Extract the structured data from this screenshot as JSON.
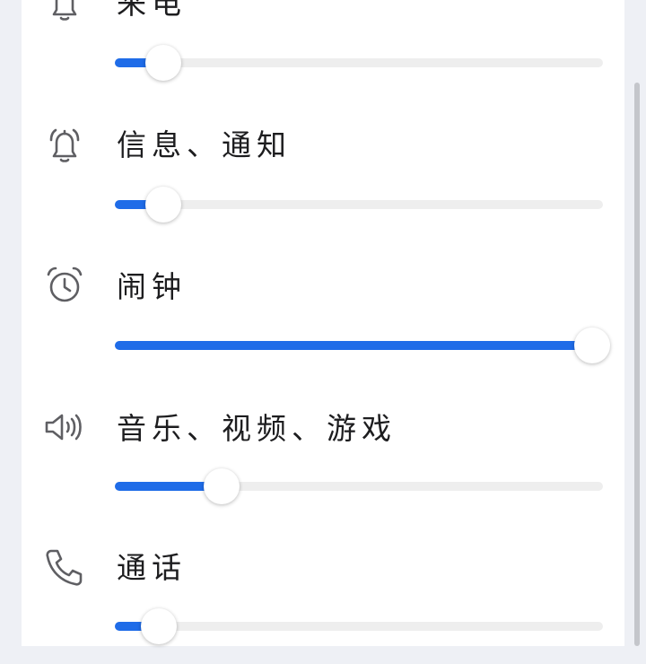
{
  "colors": {
    "accent": "#1f6ce8",
    "track": "#eeeeee",
    "icon": "#5f5f63",
    "text": "#1d1d1f"
  },
  "volume_rows": [
    {
      "label": "来电",
      "icon": "bell-icon",
      "level": 0.07
    },
    {
      "label": "信息、通知",
      "icon": "bell-ringing-icon",
      "level": 0.07
    },
    {
      "label": "闹钟",
      "icon": "alarm-clock-icon",
      "level": 1.0
    },
    {
      "label": "音乐、视频、游戏",
      "icon": "speaker-icon",
      "level": 0.19
    },
    {
      "label": "通话",
      "icon": "phone-icon",
      "level": 0.06
    }
  ]
}
